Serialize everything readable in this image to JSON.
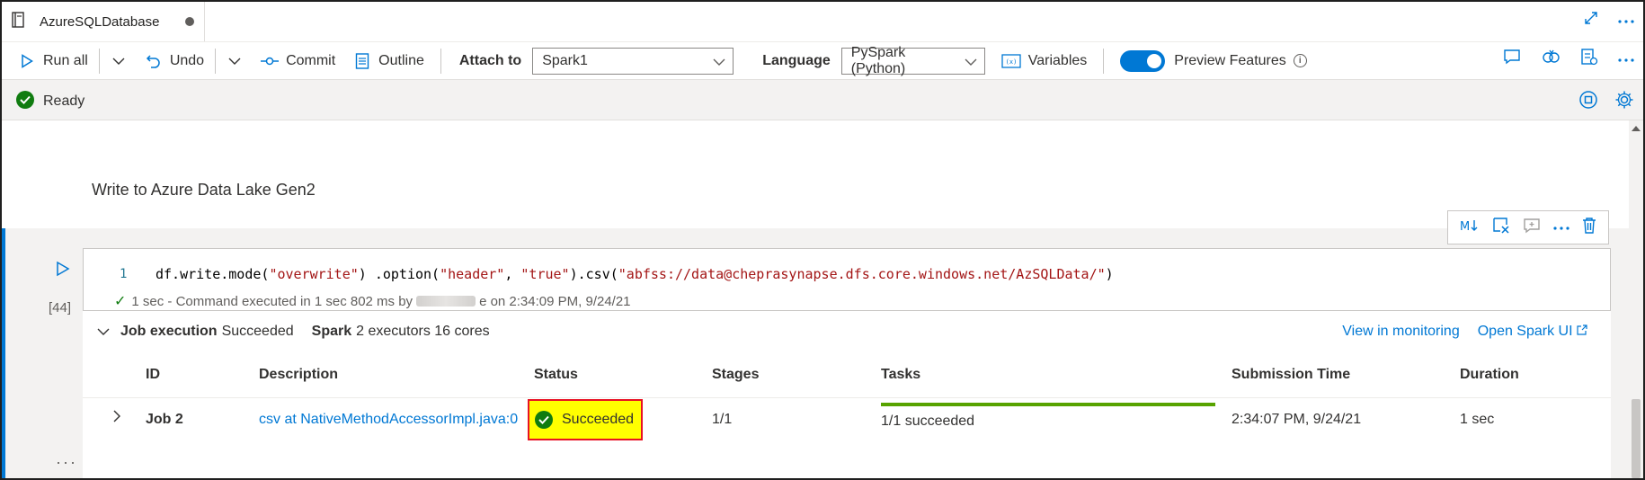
{
  "tab": {
    "title": "AzureSQLDatabase"
  },
  "toolbar": {
    "run_all": "Run all",
    "undo": "Undo",
    "commit": "Commit",
    "outline": "Outline",
    "attach_to_label": "Attach to",
    "attach_to_value": "Spark1",
    "language_label": "Language",
    "language_value": "PySpark (Python)",
    "variables": "Variables",
    "preview_features": "Preview Features"
  },
  "status": {
    "text": "Ready"
  },
  "markdown_cell": {
    "text": "Write to Azure Data Lake Gen2"
  },
  "code_cell": {
    "execution_count": "[44]",
    "line_number": "1",
    "code_prefix": "df.write.mode(",
    "arg1": "\"overwrite\"",
    "code_mid1": ") .option(",
    "arg2": "\"header\"",
    "code_mid2": ", ",
    "arg3": "\"true\"",
    "code_mid3": ").csv(",
    "arg4": "\"abfss://data@cheprasynapse.dfs.core.windows.net/AzSQLData/\"",
    "code_suffix": ")",
    "exec_info_prefix": "1 sec - Command executed in 1 sec 802 ms by",
    "exec_info_suffix": "e on 2:34:09 PM, 9/24/21"
  },
  "job_execution": {
    "label": "Job execution",
    "status": "Succeeded",
    "spark_label": "Spark",
    "spark_info": "2 executors 16 cores",
    "view_in_monitoring": "View in monitoring",
    "open_spark_ui": "Open Spark UI",
    "columns": [
      "ID",
      "Description",
      "Status",
      "Stages",
      "Tasks",
      "Submission Time",
      "Duration"
    ],
    "rows": [
      {
        "id": "Job 2",
        "description": "csv at NativeMethodAccessorImpl.java:0",
        "status": "Succeeded",
        "stages": "1/1",
        "tasks": "1/1 succeeded",
        "tasks_progress": 1.0,
        "submission_time": "2:34:07 PM, 9/24/21",
        "duration": "1 sec"
      }
    ]
  },
  "colors": {
    "accent": "#0078d4",
    "success": "#107c10",
    "highlight": "#ffff00",
    "highlight_border": "#e81123"
  }
}
